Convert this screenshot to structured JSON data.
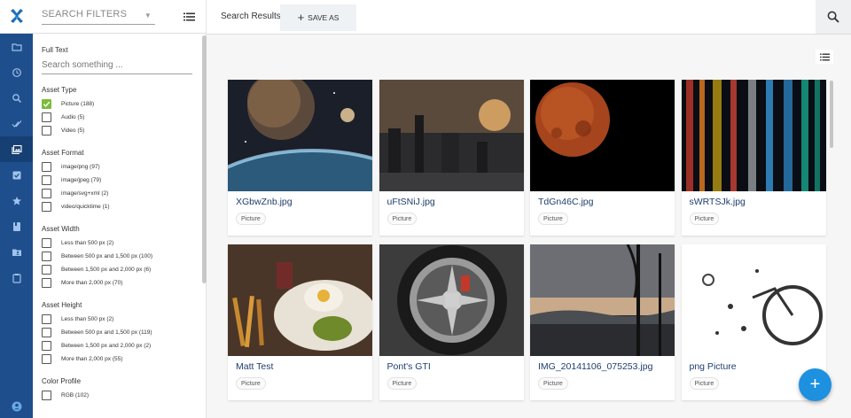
{
  "rail": {
    "nav_icons": [
      "folder-icon",
      "history-icon",
      "search-icon",
      "check-all-icon",
      "photo-library-icon",
      "checkbox-icon",
      "star-icon",
      "book-icon",
      "shared-folder-icon",
      "clipboard-icon"
    ],
    "active_index": 4,
    "account_icon": "account-circle-icon"
  },
  "filters": {
    "search_placeholder": "SEARCH FILTERS",
    "full_text": {
      "label": "Full Text",
      "placeholder": "Search something ..."
    },
    "groups": [
      {
        "title": "Asset Type",
        "options": [
          {
            "label": "Picture (188)",
            "checked": true
          },
          {
            "label": "Audio (5)",
            "checked": false
          },
          {
            "label": "Video (5)",
            "checked": false
          }
        ]
      },
      {
        "title": "Asset Format",
        "options": [
          {
            "label": "image/png (97)",
            "checked": false
          },
          {
            "label": "image/jpeg (79)",
            "checked": false
          },
          {
            "label": "image/svg+xml (2)",
            "checked": false
          },
          {
            "label": "video/quicktime (1)",
            "checked": false
          }
        ]
      },
      {
        "title": "Asset Width",
        "options": [
          {
            "label": "Less than 500 px (2)",
            "checked": false
          },
          {
            "label": "Between 500 px and 1,500 px (100)",
            "checked": false
          },
          {
            "label": "Between 1,500 px and 2,000 px (6)",
            "checked": false
          },
          {
            "label": "More than 2,000 px (70)",
            "checked": false
          }
        ]
      },
      {
        "title": "Asset Height",
        "options": [
          {
            "label": "Less than 500 px (2)",
            "checked": false
          },
          {
            "label": "Between 500 px and 1,500 px (119)",
            "checked": false
          },
          {
            "label": "Between 1,500 px and 2,000 px (2)",
            "checked": false
          },
          {
            "label": "More than 2,000 px (55)",
            "checked": false
          }
        ]
      },
      {
        "title": "Color Profile",
        "options": [
          {
            "label": "RGB (102)",
            "checked": false
          }
        ]
      }
    ]
  },
  "topbar": {
    "title": "Search Results",
    "save_as_label": "SAVE AS"
  },
  "assets": [
    {
      "name": "XGbwZnb.jpg",
      "type": "Picture",
      "thumb": "planet"
    },
    {
      "name": "uFtSNiJ.jpg",
      "type": "Picture",
      "thumb": "scifi-city"
    },
    {
      "name": "TdGn46C.jpg",
      "type": "Picture",
      "thumb": "blood-moon"
    },
    {
      "name": "sWRTSJk.jpg",
      "type": "Picture",
      "thumb": "color-streaks"
    },
    {
      "name": "Matt Test",
      "type": "Picture",
      "thumb": "food-plate"
    },
    {
      "name": "Pont's GTI",
      "type": "Picture",
      "thumb": "car-wheel"
    },
    {
      "name": "IMG_20141106_075253.jpg",
      "type": "Picture",
      "thumb": "sunset-trees"
    },
    {
      "name": "png Picture",
      "type": "Picture",
      "thumb": "bicycle-sketch"
    }
  ],
  "fab_label": "+"
}
